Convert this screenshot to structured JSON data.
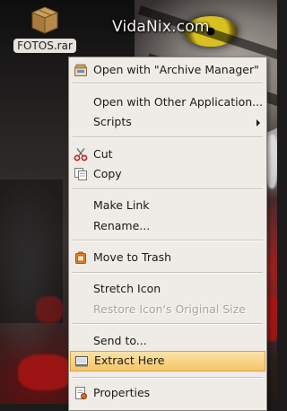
{
  "watermark": "VidaNix.com",
  "desktop_icon": {
    "label": "FOTOS.rar",
    "icon": "archive-box-icon"
  },
  "menu": {
    "open_with_archive": {
      "label": "Open with \"Archive Manager\"",
      "icon": "archive-manager-icon",
      "mnemonic": "O"
    },
    "open_with_other": {
      "label": "Open with Other Application...",
      "mnemonic": "A"
    },
    "scripts": {
      "label": "Scripts",
      "mnemonic": "S",
      "submenu": true
    },
    "cut": {
      "label": "Cut",
      "icon": "scissors-icon",
      "mnemonic": "t"
    },
    "copy": {
      "label": "Copy",
      "icon": "copy-icon",
      "mnemonic": "C"
    },
    "make_link": {
      "label": "Make Link",
      "mnemonic": "k"
    },
    "rename": {
      "label": "Rename...",
      "mnemonic": "R"
    },
    "move_to_trash": {
      "label": "Move to Trash",
      "icon": "trash-icon",
      "mnemonic": "v"
    },
    "stretch_icon": {
      "label": "Stretch Icon",
      "mnemonic": "t"
    },
    "restore_icon": {
      "label": "Restore Icon's Original Size",
      "disabled": true
    },
    "send_to": {
      "label": "Send to...",
      "mnemonic": "n"
    },
    "extract_here": {
      "label": "Extract Here",
      "icon": "extract-here-icon",
      "highlighted": true
    },
    "properties": {
      "label": "Properties",
      "icon": "properties-icon",
      "mnemonic": "P"
    }
  },
  "colors": {
    "menu_bg": "#efebe7",
    "highlight": "#f3c56a",
    "highlight_border": "#d9a441",
    "disabled_text": "#aaa39c"
  }
}
